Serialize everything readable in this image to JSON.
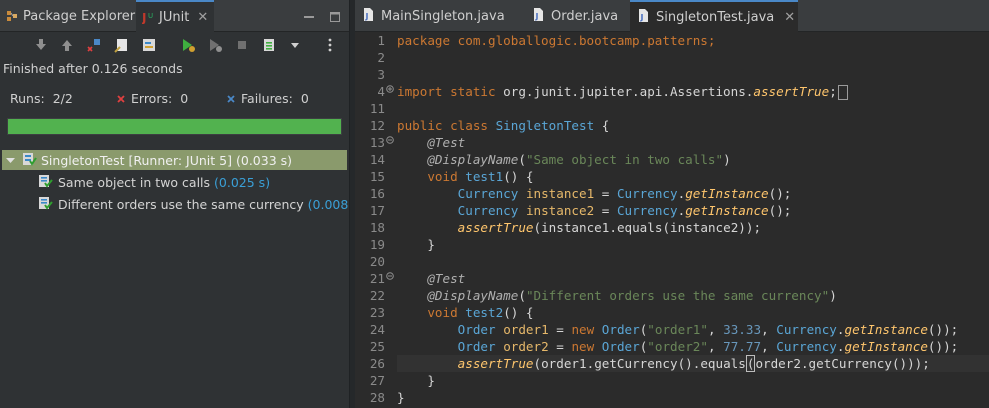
{
  "left_tabs": [
    {
      "label": "Package Explorer",
      "icon": "package-explorer-icon",
      "active": false
    },
    {
      "label": "JUnit",
      "icon": "junit-icon",
      "active": true
    }
  ],
  "close_symbol": "✕",
  "status": "Finished after 0.126 seconds",
  "counts": {
    "runs_label": "Runs:",
    "runs_value": "2/2",
    "errors_label": "Errors:",
    "errors_value": "0",
    "failures_label": "Failures:",
    "failures_value": "0"
  },
  "progress": {
    "fraction": 1.0,
    "color": "#52b24f"
  },
  "tree": {
    "root": {
      "label": "SingletonTest [Runner: JUnit 5]",
      "time": "(0.033 s)"
    },
    "tests": [
      {
        "label": "Same object in two calls",
        "time": "(0.025 s)"
      },
      {
        "label": "Different orders use the same currency",
        "time": "(0.008 s)"
      }
    ]
  },
  "editor_tabs": [
    {
      "label": "MainSingleton.java",
      "active": false
    },
    {
      "label": "Order.java",
      "active": false
    },
    {
      "label": "SingletonTest.java",
      "active": true
    }
  ],
  "line_numbers": [
    "1",
    "2",
    "3",
    "4",
    "11",
    "12",
    "13",
    "14",
    "15",
    "16",
    "17",
    "18",
    "19",
    "20",
    "21",
    "22",
    "23",
    "24",
    "25",
    "26",
    "27",
    "28"
  ],
  "code": {
    "l1": "package com.globallogic.bootcamp.patterns;",
    "l4_kw": "import static ",
    "l4_pkg": "org.junit.jupiter.api.Assertions.",
    "l4_m": "assertTrue",
    "l4_end": ";",
    "l12_kw": "public class ",
    "l12_cls": "SingletonTest",
    "l12_end": " {",
    "ann_test": "@Test",
    "ann_dn": "@DisplayName",
    "s1": "\"Same object in two calls\"",
    "s2": "\"Different orders use the same currency\"",
    "void": "void ",
    "test1": "test1",
    "test2": "test2",
    "sig_end": "() {",
    "currency": "Currency",
    "instance1": "instance1",
    "instance2": "instance2",
    "getInstance": "getInstance",
    "assertTrue": "assertTrue",
    "order": "Order",
    "order1": "order1",
    "order2": "order2",
    "new": "new ",
    "so1": "\"order1\"",
    "so2": "\"order2\"",
    "n1": "33.33",
    "n2": "77.77",
    "equals": "equals",
    "getCurrency": "getCurrency",
    "close_brace": "}"
  },
  "colors": {
    "background": "#2b2b2b",
    "keyword": "#cc7832",
    "type": "#5aa6d6",
    "string": "#6a8759",
    "accent": "#4a88c7"
  }
}
